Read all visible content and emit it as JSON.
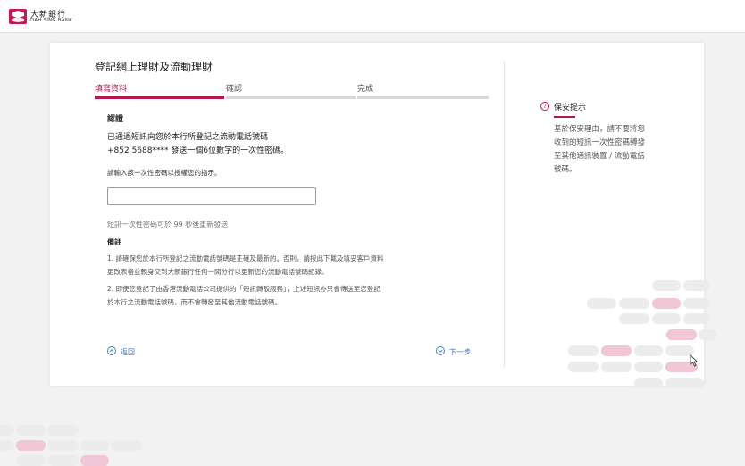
{
  "brand": {
    "name_cn": "大新銀行",
    "name_en": "DAH SING BANK",
    "logo_icon": "dah-sing-logo-icon"
  },
  "page": {
    "title": "登記網上理財及流動理財"
  },
  "steps": [
    {
      "label": "填寫資料",
      "active": true
    },
    {
      "label": "確認",
      "active": false
    },
    {
      "label": "完成",
      "active": false
    }
  ],
  "verification": {
    "section_title": "認證",
    "message_line1": "已通過短訊向您於本行所登記之流動電話號碼",
    "message_line2": "+852 5688**** 發送一個6位數字的一次性密碼。",
    "prompt": "請輸入該一次性密碼以授權您的指示。",
    "otp_value": "",
    "otp_placeholder": "",
    "resend_text": "短訊一次性密碼可於 99 秒後重新發送"
  },
  "notes": {
    "title": "備註",
    "lines": [
      "1. 請確保您於本行所登記之流動電話號碼是正確及最新的。否則，請按此下載及填妥客戶資料",
      "    更改表格並親身交到大新銀行任何一間分行以更新您的流動電話號碼紀錄。",
      "2. 即使您登記了由香港流動電話公司提供的「短訊轉駁服務」，上述短訊亦只會傳送至您登記",
      "    於本行之流動電話號碼，而不會轉發至其他流動電話號碼。"
    ]
  },
  "nav": {
    "back_label": "返回",
    "next_label": "下一步",
    "back_icon": "chevron-up-circle-icon",
    "next_icon": "chevron-down-circle-icon"
  },
  "security_tip": {
    "icon": "question-circle-icon",
    "title": "保安提示",
    "lines": [
      "基於保安理由，請不要將您",
      "收到的短訊一次性密碼轉發",
      "至其他通訊裝置 / 流動電話",
      "號碼。"
    ]
  },
  "colors": {
    "accent": "#b5174f",
    "link": "#3a6cb3",
    "pill_gray": "#ececec",
    "pill_pink": "#f1c6d6"
  }
}
